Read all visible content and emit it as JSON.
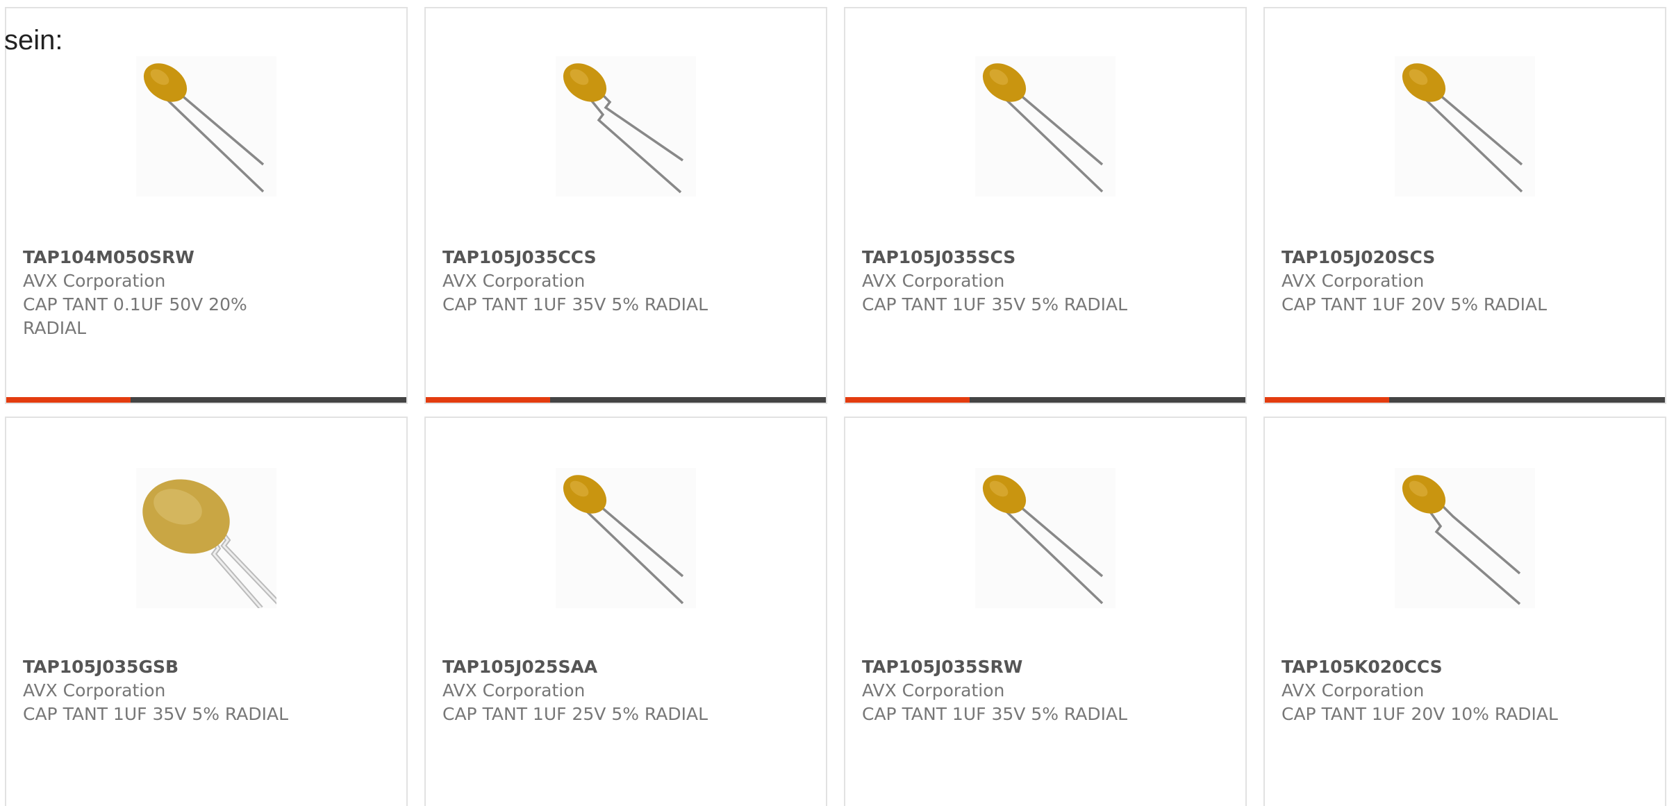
{
  "intro_text": "sein:",
  "colors": {
    "accent": "#e33c0f",
    "bar_track": "#444444",
    "card_border": "#e2e2e2"
  },
  "products": [
    {
      "part": "TAP104M050SRW",
      "manufacturer": "AVX Corporation",
      "description": "CAP TANT 0.1UF 50V 20% RADIAL",
      "image": "dipped-tantalum-capacitor",
      "progress": 0.31
    },
    {
      "part": "TAP105J035CCS",
      "manufacturer": "AVX Corporation",
      "description": "CAP TANT 1UF 35V 5% RADIAL",
      "image": "dipped-tantalum-capacitor-kinked-leads",
      "progress": 0.31
    },
    {
      "part": "TAP105J035SCS",
      "manufacturer": "AVX Corporation",
      "description": "CAP TANT 1UF 35V 5% RADIAL",
      "image": "dipped-tantalum-capacitor",
      "progress": 0.31
    },
    {
      "part": "TAP105J020SCS",
      "manufacturer": "AVX Corporation",
      "description": "CAP TANT 1UF 20V 5% RADIAL",
      "image": "dipped-tantalum-capacitor",
      "progress": 0.31
    },
    {
      "part": "TAP105J035GSB",
      "manufacturer": "AVX Corporation",
      "description": "CAP TANT 1UF 35V 5% RADIAL",
      "image": "disc-tantalum-capacitor"
    },
    {
      "part": "TAP105J025SAA",
      "manufacturer": "AVX Corporation",
      "description": "CAP TANT 1UF 25V 5% RADIAL",
      "image": "dipped-tantalum-capacitor"
    },
    {
      "part": "TAP105J035SRW",
      "manufacturer": "AVX Corporation",
      "description": "CAP TANT 1UF 35V 5% RADIAL",
      "image": "dipped-tantalum-capacitor"
    },
    {
      "part": "TAP105K020CCS",
      "manufacturer": "AVX Corporation",
      "description": "CAP TANT 1UF 20V 10% RADIAL",
      "image": "dipped-tantalum-capacitor-kinked-leads"
    }
  ]
}
